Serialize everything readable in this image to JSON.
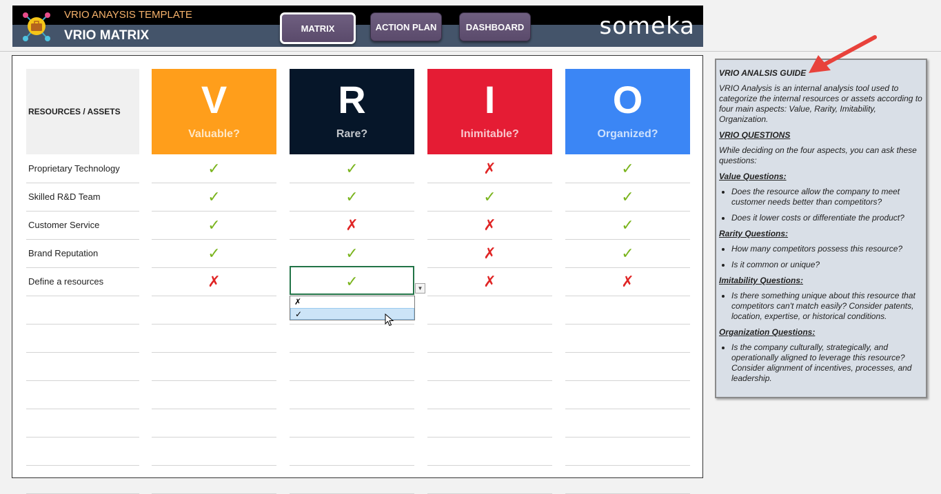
{
  "header": {
    "subtitle": "VRIO ANAYSIS TEMPLATE",
    "title": "VRIO MATRIX",
    "brand": "someka",
    "nav": [
      {
        "label": "MATRIX"
      },
      {
        "label": "ACTION PLAN"
      },
      {
        "label": "DASHBOARD"
      }
    ]
  },
  "matrix": {
    "resources_header": "RESOURCES / ASSETS",
    "columns": [
      {
        "letter": "V",
        "question": "Valuable?",
        "color": "#ff9e1b"
      },
      {
        "letter": "R",
        "question": "Rare?",
        "color": "#061629"
      },
      {
        "letter": "I",
        "question": "Inimitable?",
        "color": "#e51c34"
      },
      {
        "letter": "O",
        "question": "Organized?",
        "color": "#3b86f5"
      }
    ],
    "rows": [
      {
        "label": "Proprietary Technology",
        "marks": [
          "✓",
          "✓",
          "✗",
          "✓"
        ]
      },
      {
        "label": "Skilled R&D Team",
        "marks": [
          "✓",
          "✓",
          "✓",
          "✓"
        ]
      },
      {
        "label": "Customer Service",
        "marks": [
          "✓",
          "✗",
          "✗",
          "✓"
        ]
      },
      {
        "label": "Brand Reputation",
        "marks": [
          "✓",
          "✓",
          "✗",
          "✓"
        ]
      },
      {
        "label": "Define a resources",
        "marks": [
          "✗",
          "✓",
          "✗",
          "✗"
        ]
      }
    ],
    "dropdown": {
      "options": [
        "✗",
        "✓"
      ],
      "highlighted": "✓"
    }
  },
  "guide": {
    "title": "VRIO ANALSIS GUIDE",
    "intro": "VRIO Analysis is an internal analysis tool used to categorize the internal resources or assets according to four main aspects: Value, Rarity, Imitability, Organization.",
    "questions_title": "VRIO QUESTIONS",
    "questions_intro": "While deciding on the four aspects, you can ask these questions:",
    "value_title": "Value Questions:",
    "value_items": [
      "Does the resource allow the company to meet customer needs better than competitors?",
      "Does it lower costs or differentiate the product?"
    ],
    "rarity_title": "Rarity Questions:",
    "rarity_items": [
      "How many competitors possess this resource?",
      "Is it common or unique?"
    ],
    "imitability_title": "Imitability Questions:",
    "imitability_items": [
      "Is there something unique about this resource that competitors can't match easily? Consider patents, location, expertise, or historical conditions."
    ],
    "organization_title": "Organization Questions:",
    "organization_items": [
      "Is the company culturally, strategically, and operationally aligned to leverage this resource? Consider alignment of incentives, processes, and leadership."
    ]
  }
}
